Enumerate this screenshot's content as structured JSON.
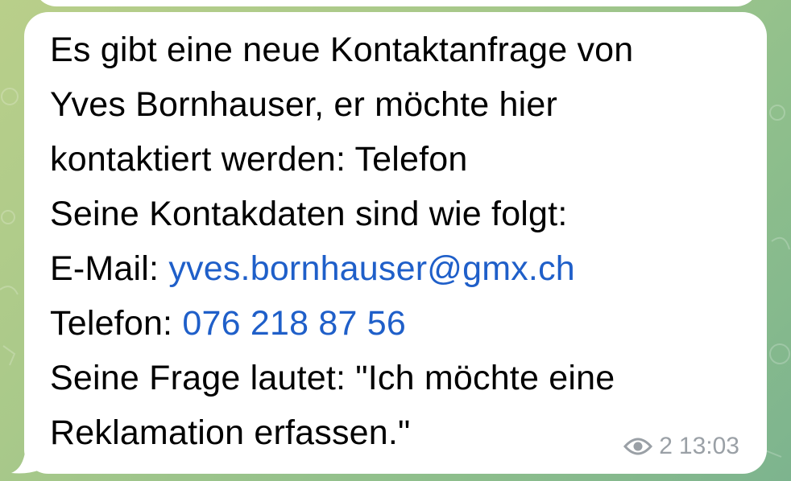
{
  "message": {
    "lines": [
      "Es gibt eine neue Kontaktanfrage von",
      "Yves Bornhauser, er möchte hier",
      "kontaktiert werden: Telefon",
      "Seine Kontakdaten sind wie folgt:"
    ],
    "email_label": "E-Mail: ",
    "email_value": "yves.bornhauser@gmx.ch",
    "phone_label": "Telefon: ",
    "phone_value": "076 218 87 56",
    "question_lines": [
      "Seine Frage lautet: \"Ich möchte eine",
      "Reklamation erfassen.\""
    ]
  },
  "meta": {
    "views": "2",
    "time": "13:03",
    "view_icon": "eye-icon"
  },
  "colors": {
    "link": "#1f5fc9",
    "meta": "#9aa0a6",
    "bubble": "#ffffff"
  }
}
